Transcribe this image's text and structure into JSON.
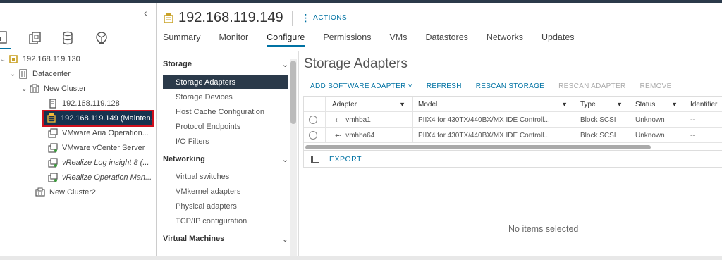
{
  "navigator": {
    "collapse_glyph": "‹",
    "icons": [
      "hosts-and-clusters-icon",
      "vms-and-templates-icon",
      "storage-icon",
      "networking-icon"
    ],
    "tree": [
      {
        "label": "192.168.119.130",
        "icon": "vcenter-icon"
      },
      {
        "label": "Datacenter",
        "icon": "datacenter-icon"
      },
      {
        "label": "New Cluster",
        "icon": "cluster-icon"
      },
      {
        "label": "192.168.119.128",
        "icon": "host-icon"
      },
      {
        "label": "192.168.119.149 (Mainten...",
        "icon": "host-maintenance-icon"
      },
      {
        "label": "VMware Aria Operation...",
        "icon": "vm-icon"
      },
      {
        "label": "VMware vCenter Server",
        "icon": "vm-icon"
      },
      {
        "label": "vRealize Log insight 8 (...",
        "icon": "vm-icon"
      },
      {
        "label": "vRealize Operation Man...",
        "icon": "vm-icon"
      },
      {
        "label": "New Cluster2",
        "icon": "cluster-icon"
      }
    ]
  },
  "header": {
    "title": "192.168.119.149",
    "actions_label": "ACTIONS"
  },
  "tabs": [
    "Summary",
    "Monitor",
    "Configure",
    "Permissions",
    "VMs",
    "Datastores",
    "Networks",
    "Updates"
  ],
  "active_tab": "Configure",
  "configure_menu": {
    "storage": {
      "title": "Storage",
      "items": [
        "Storage Adapters",
        "Storage Devices",
        "Host Cache Configuration",
        "Protocol Endpoints",
        "I/O Filters"
      ]
    },
    "networking": {
      "title": "Networking",
      "items": [
        "Virtual switches",
        "VMkernel adapters",
        "Physical adapters",
        "TCP/IP configuration"
      ]
    },
    "virtual_machines": {
      "title": "Virtual Machines"
    }
  },
  "pane": {
    "title": "Storage Adapters",
    "toolbar": {
      "add": "ADD SOFTWARE ADAPTER ˅",
      "refresh": "REFRESH",
      "rescan_storage": "RESCAN STORAGE",
      "rescan_adapter": "RESCAN ADAPTER",
      "remove": "REMOVE"
    },
    "columns": [
      "Adapter",
      "Model",
      "Type",
      "Status",
      "Identifier"
    ],
    "rows": [
      {
        "adapter": "vmhba1",
        "model": "PIIX4 for 430TX/440BX/MX IDE Controll...",
        "type": "Block SCSI",
        "status": "Unknown",
        "identifier": "--"
      },
      {
        "adapter": "vmhba64",
        "model": "PIIX4 for 430TX/440BX/MX IDE Controll...",
        "type": "Block SCSI",
        "status": "Unknown",
        "identifier": "--"
      }
    ],
    "export_label": "EXPORT",
    "no_selection": "No items selected"
  },
  "colors": {
    "accent": "#0072a3",
    "selected_nav_bg": "#16324f",
    "highlight_box": "#d0101e",
    "active_menu_bg": "#2b3a4a"
  }
}
